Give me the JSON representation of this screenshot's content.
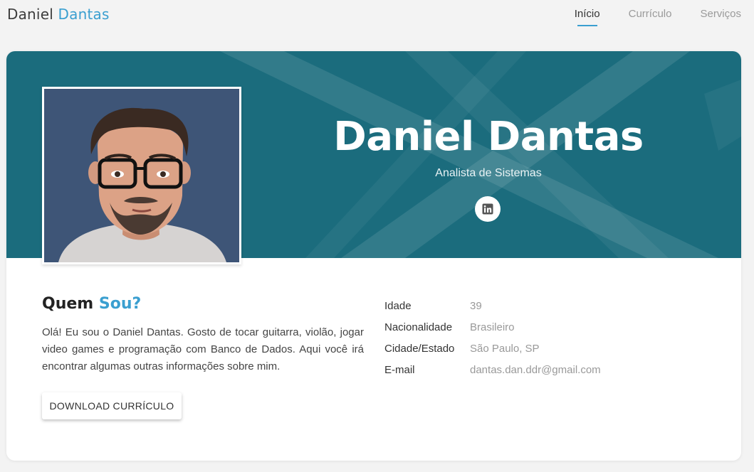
{
  "brand": {
    "first": "Daniel",
    "last": "Dantas"
  },
  "nav": {
    "items": [
      {
        "label": "Início",
        "active": true
      },
      {
        "label": "Currículo",
        "active": false
      },
      {
        "label": "Serviços",
        "active": false
      }
    ]
  },
  "hero": {
    "name": "Daniel Dantas",
    "role": "Analista de Sistemas",
    "social_icon": "linkedin-icon"
  },
  "about": {
    "title_first": "Quem",
    "title_accent": "Sou?",
    "text": "Olá! Eu sou o Daniel Dantas. Gosto de tocar guitarra, violão, jogar video games e programação com Banco de Dados. Aqui você irá encontrar algumas outras informações sobre mim.",
    "download_label": "DOWNLOAD CURRÍCULO"
  },
  "info": {
    "rows": [
      {
        "label": "Idade",
        "value": "39"
      },
      {
        "label": "Nacionalidade",
        "value": "Brasileiro"
      },
      {
        "label": "Cidade/Estado",
        "value": "São Paulo, SP"
      },
      {
        "label": "E-mail",
        "value": "dantas.dan.ddr@gmail.com"
      }
    ]
  },
  "colors": {
    "accent": "#3a9fd0",
    "banner": "#1b6c7d"
  }
}
